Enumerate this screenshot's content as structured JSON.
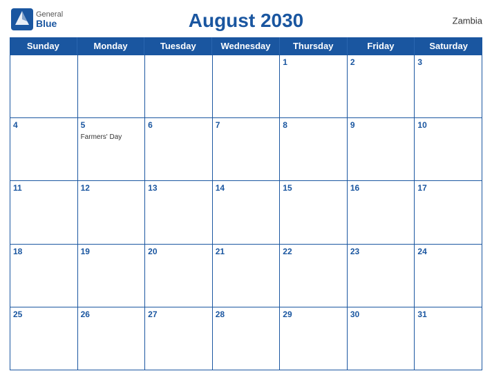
{
  "header": {
    "logo_general": "General",
    "logo_blue": "Blue",
    "title": "August 2030",
    "country": "Zambia"
  },
  "days": [
    "Sunday",
    "Monday",
    "Tuesday",
    "Wednesday",
    "Thursday",
    "Friday",
    "Saturday"
  ],
  "weeks": [
    [
      {
        "day": "",
        "event": ""
      },
      {
        "day": "",
        "event": ""
      },
      {
        "day": "",
        "event": ""
      },
      {
        "day": "",
        "event": ""
      },
      {
        "day": "1",
        "event": ""
      },
      {
        "day": "2",
        "event": ""
      },
      {
        "day": "3",
        "event": ""
      }
    ],
    [
      {
        "day": "4",
        "event": ""
      },
      {
        "day": "5",
        "event": "Farmers' Day"
      },
      {
        "day": "6",
        "event": ""
      },
      {
        "day": "7",
        "event": ""
      },
      {
        "day": "8",
        "event": ""
      },
      {
        "day": "9",
        "event": ""
      },
      {
        "day": "10",
        "event": ""
      }
    ],
    [
      {
        "day": "11",
        "event": ""
      },
      {
        "day": "12",
        "event": ""
      },
      {
        "day": "13",
        "event": ""
      },
      {
        "day": "14",
        "event": ""
      },
      {
        "day": "15",
        "event": ""
      },
      {
        "day": "16",
        "event": ""
      },
      {
        "day": "17",
        "event": ""
      }
    ],
    [
      {
        "day": "18",
        "event": ""
      },
      {
        "day": "19",
        "event": ""
      },
      {
        "day": "20",
        "event": ""
      },
      {
        "day": "21",
        "event": ""
      },
      {
        "day": "22",
        "event": ""
      },
      {
        "day": "23",
        "event": ""
      },
      {
        "day": "24",
        "event": ""
      }
    ],
    [
      {
        "day": "25",
        "event": ""
      },
      {
        "day": "26",
        "event": ""
      },
      {
        "day": "27",
        "event": ""
      },
      {
        "day": "28",
        "event": ""
      },
      {
        "day": "29",
        "event": ""
      },
      {
        "day": "30",
        "event": ""
      },
      {
        "day": "31",
        "event": ""
      }
    ]
  ],
  "colors": {
    "primary": "#1a56a0",
    "header_text": "#ffffff",
    "border": "#1a56a0"
  }
}
